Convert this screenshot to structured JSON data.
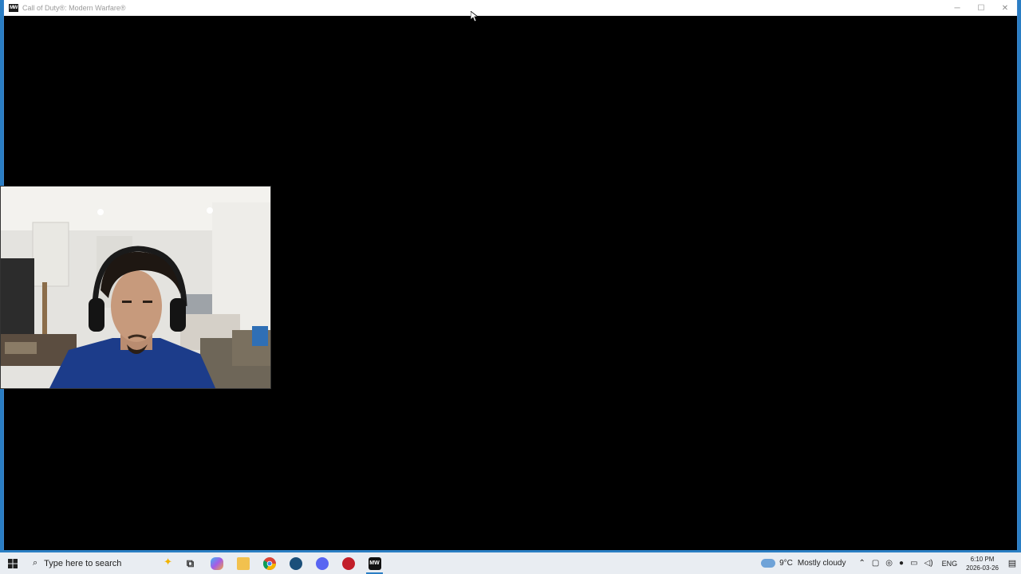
{
  "window": {
    "title": "Call of Duty®: Modern Warfare®",
    "app_icon_text": "MW",
    "controls": {
      "minimize": "─",
      "maximize": "☐",
      "close": "✕"
    }
  },
  "taskbar": {
    "search_placeholder": "Type here to search",
    "pinned": [
      {
        "name": "task-view",
        "glyph": "⧉",
        "color": "#3a3a3a"
      },
      {
        "name": "copilot",
        "glyph": "",
        "color": "#7d5ce6"
      },
      {
        "name": "file-explorer",
        "glyph": "",
        "color": "#f2c14e"
      },
      {
        "name": "chrome",
        "glyph": "",
        "color": "#db4437"
      },
      {
        "name": "steam",
        "glyph": "",
        "color": "#1b4f7a"
      },
      {
        "name": "discord",
        "glyph": "",
        "color": "#5865f2"
      },
      {
        "name": "obs",
        "glyph": "",
        "color": "#c21f2a"
      },
      {
        "name": "modern-warfare",
        "glyph": "MW",
        "color": "#111111"
      }
    ],
    "weather": {
      "temp": "9°C",
      "condition": "Mostly cloudy"
    },
    "language": "ENG",
    "time": "6:10 PM",
    "date": "2026-03-26"
  }
}
